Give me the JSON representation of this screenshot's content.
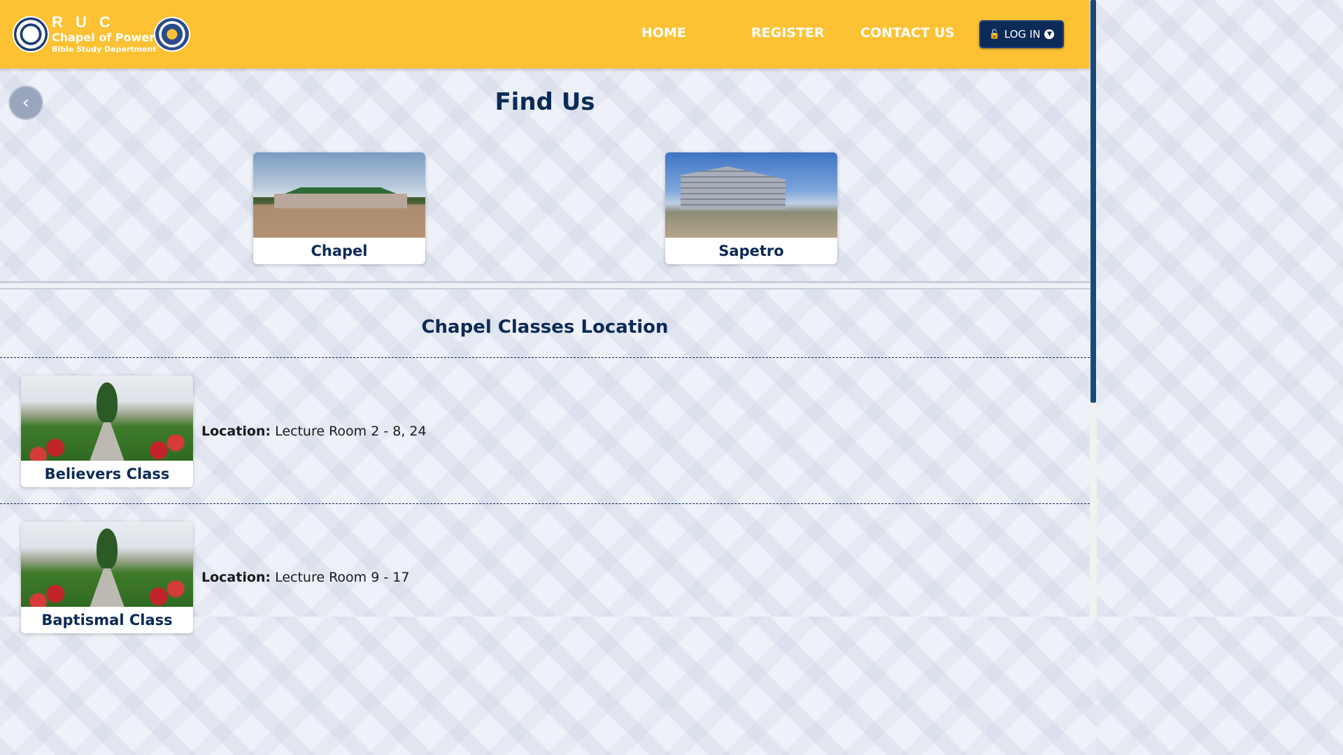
{
  "brand": {
    "initials": "R U C",
    "name": "Chapel of Power",
    "department": "Bible Study Department"
  },
  "nav": {
    "home": "HOME",
    "register": "REGISTER",
    "contact": "CONTACT US",
    "login": "LOG IN"
  },
  "page": {
    "title": "Find Us"
  },
  "locations": [
    {
      "name": "Chapel"
    },
    {
      "name": "Sapetro"
    }
  ],
  "classes_section": {
    "title": "Chapel Classes Location",
    "location_label": "Location:",
    "classes": [
      {
        "name": "Believers Class",
        "location": "Lecture Room 2 - 8, 24"
      },
      {
        "name": "Baptismal Class",
        "location": "Lecture Room 9 - 17"
      }
    ]
  },
  "colors": {
    "header": "#fdc234",
    "primary": "#0c2a56"
  },
  "icons": {
    "back": "chevron-left-icon",
    "login_lock": "unlock-icon",
    "login_dropdown": "chevron-down-circle-icon"
  }
}
